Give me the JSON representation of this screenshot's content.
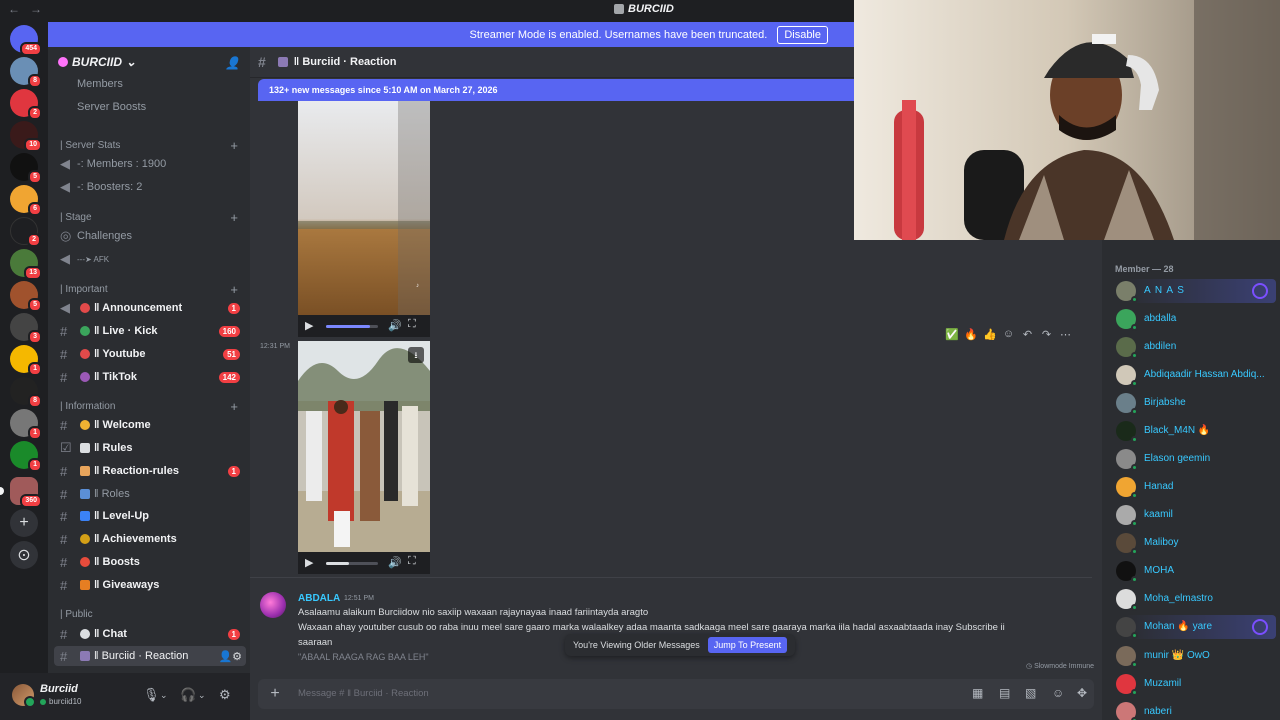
{
  "titlebar": {
    "title": "BURCIID",
    "back": "←",
    "forward": "→"
  },
  "banner": {
    "text": "Streamer Mode is enabled. Usernames have been truncated.",
    "button": "Disable"
  },
  "rail": {
    "badges": [
      "454",
      "8",
      "2",
      "10",
      "5",
      "6",
      "2",
      "13",
      "5",
      "3",
      "1",
      "8",
      "1",
      "1",
      "360"
    ],
    "add": "+",
    "explore": "⊙"
  },
  "guild": {
    "name": "BURCIID",
    "chevron": "⌄",
    "invite": "👤"
  },
  "sidebar": {
    "top": [
      {
        "label": "Members"
      },
      {
        "label": "Server Boosts"
      }
    ],
    "categories": {
      "server_stats": "| Server Stats",
      "stage": "| Stage",
      "important": "| Important",
      "information": "| Information",
      "public": "| Public"
    },
    "voice": [
      {
        "label": "-: Members : 1900"
      },
      {
        "label": "-: Boosters: 2"
      },
      {
        "label": "Challenges"
      },
      {
        "label": "---➤ AFK"
      }
    ],
    "channels": [
      {
        "label": "‖ Announcement",
        "count": "1"
      },
      {
        "label": "‖ Live · Kick",
        "count": "160"
      },
      {
        "label": "‖ Youtube",
        "count": "51"
      },
      {
        "label": "‖ TikTok",
        "count": "142"
      },
      {
        "label": "‖ Welcome",
        "count": ""
      },
      {
        "label": "‖ Rules",
        "count": ""
      },
      {
        "label": "‖ Reaction-rules",
        "count": "1"
      },
      {
        "label": "‖ Roles",
        "count": ""
      },
      {
        "label": "‖ Level-Up",
        "count": ""
      },
      {
        "label": "‖ Achievements",
        "count": ""
      },
      {
        "label": "‖ Boosts",
        "count": ""
      },
      {
        "label": "‖ Giveaways",
        "count": ""
      },
      {
        "label": "‖ Chat",
        "count": "1"
      },
      {
        "label": "‖ Burciid · Reaction",
        "count": ""
      }
    ]
  },
  "user": {
    "name": "Burciid",
    "tag": "burciid10"
  },
  "chat": {
    "channel": "‖ Burciid · Reaction",
    "new_messages": "132+ new messages since 5:10 AM on March 27, 2026",
    "video_timestamp": "12:31 PM",
    "message": {
      "author": "ABDALA",
      "time": "12:51 PM",
      "lines": [
        "Asalaamu alaikum Burciidow nio saxiip waxaan rajaynayaa inaad fariintayda aragto",
        "Waxaan ahay youtuber cusub oo raba inuu meel sare gaaro marka walaalkey adaa maanta sadkaaga meel sare gaaraya marka iila hadal asxaabtaada inay Subscribe ii",
        "saaraan"
      ],
      "quote": "\"ABAAL RAAGA RAG BAA LEH\""
    },
    "older_text": "You're Viewing Older Messages",
    "jump_label": "Jump To Present",
    "slowmode": "Slowmode Immune",
    "composer_placeholder": "Message # ‖ Burciid · Reaction"
  },
  "members": {
    "header": "Member — 28",
    "list": [
      "A N A S",
      "abdalla",
      "abdilen",
      "Abdiqaadir Hassan Abdiq...",
      "Birjabshe",
      "Black_M4N 🔥",
      "Elason geemin",
      "Hanad",
      "kaamil",
      "Maliboy",
      "MOHA",
      "Moha_elmastro",
      "Mohan 🔥 yare",
      "munir 👑 OwO",
      "Muzamil",
      "naberi"
    ]
  },
  "colors": {
    "accent": "#5865f2",
    "danger": "#f23f43",
    "online": "#23a55a",
    "member_name": "#38c9ff"
  }
}
